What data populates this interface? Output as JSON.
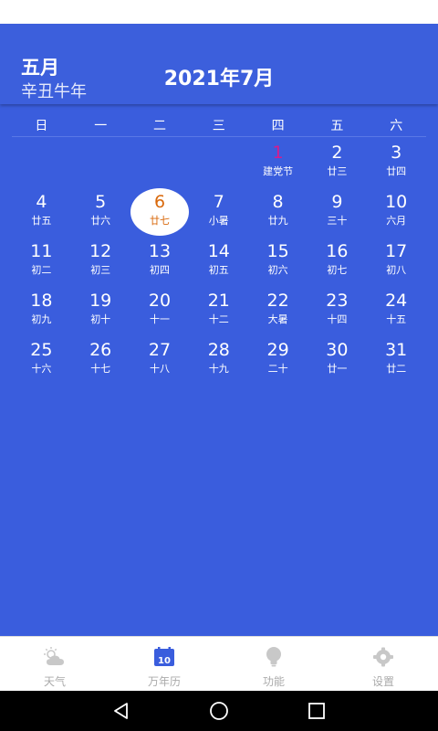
{
  "header": {
    "lunar_month": "五月",
    "lunar_year": "辛丑牛年",
    "title": "2021年7月"
  },
  "weekdays": [
    "日",
    "一",
    "二",
    "三",
    "四",
    "五",
    "六"
  ],
  "days": [
    {
      "num": "1",
      "sub": "建党节",
      "holiday": true
    },
    {
      "num": "2",
      "sub": "廿三"
    },
    {
      "num": "3",
      "sub": "廿四"
    },
    {
      "num": "4",
      "sub": "廿五"
    },
    {
      "num": "5",
      "sub": "廿六"
    },
    {
      "num": "6",
      "sub": "廿七",
      "today": true
    },
    {
      "num": "7",
      "sub": "小暑"
    },
    {
      "num": "8",
      "sub": "廿九"
    },
    {
      "num": "9",
      "sub": "三十"
    },
    {
      "num": "10",
      "sub": "六月"
    },
    {
      "num": "11",
      "sub": "初二"
    },
    {
      "num": "12",
      "sub": "初三"
    },
    {
      "num": "13",
      "sub": "初四"
    },
    {
      "num": "14",
      "sub": "初五"
    },
    {
      "num": "15",
      "sub": "初六"
    },
    {
      "num": "16",
      "sub": "初七"
    },
    {
      "num": "17",
      "sub": "初八"
    },
    {
      "num": "18",
      "sub": "初九"
    },
    {
      "num": "19",
      "sub": "初十"
    },
    {
      "num": "20",
      "sub": "十一"
    },
    {
      "num": "21",
      "sub": "十二"
    },
    {
      "num": "22",
      "sub": "大暑"
    },
    {
      "num": "23",
      "sub": "十四"
    },
    {
      "num": "24",
      "sub": "十五"
    },
    {
      "num": "25",
      "sub": "十六"
    },
    {
      "num": "26",
      "sub": "十七"
    },
    {
      "num": "27",
      "sub": "十八"
    },
    {
      "num": "28",
      "sub": "十九"
    },
    {
      "num": "29",
      "sub": "二十"
    },
    {
      "num": "30",
      "sub": "廿一"
    },
    {
      "num": "31",
      "sub": "廿二"
    }
  ],
  "first_weekday": 4,
  "bottom_nav": [
    {
      "label": "天气",
      "icon": "weather-cloud-sun-icon",
      "active": false
    },
    {
      "label": "万年历",
      "icon": "calendar-icon",
      "active": true
    },
    {
      "label": "功能",
      "icon": "lightbulb-icon",
      "active": false
    },
    {
      "label": "设置",
      "icon": "settings-gear-icon",
      "active": false
    }
  ],
  "colors": {
    "background": "#3a5ddd",
    "today_text": "#d9690c",
    "holiday_text": "#d81b8c",
    "nav_active_icon": "#3a5ddd",
    "nav_inactive": "#c8c8c8"
  }
}
